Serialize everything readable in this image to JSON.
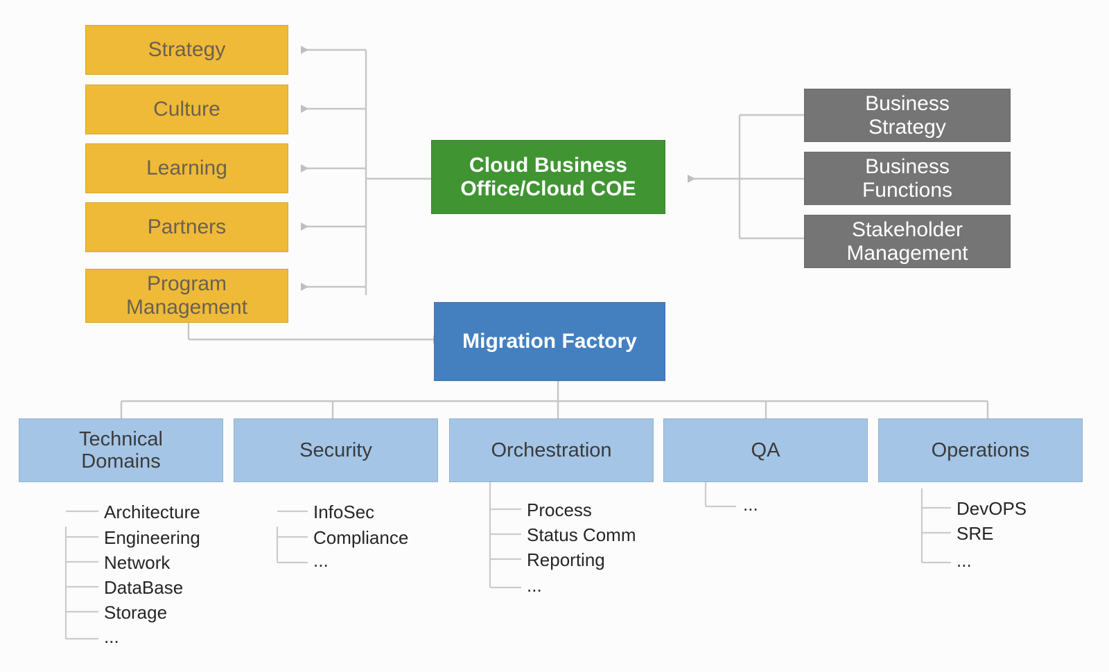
{
  "diagram": {
    "title": "Cloud Business Office / Migration Factory operating model",
    "colors": {
      "yellow": "#EFBA37",
      "green": "#409532",
      "gray": "#757575",
      "blue": "#4480C0",
      "light_blue": "#A4C5E5",
      "connector": "#BFBFBF",
      "background": "#FCFCFC"
    }
  },
  "hub": {
    "label": "Cloud Business\nOffice/Cloud COE",
    "line1": "Cloud Business",
    "line2": "Office/Cloud COE"
  },
  "factory": {
    "label": "Migration Factory"
  },
  "left_pillars": [
    {
      "label": "Strategy",
      "line1": "Strategy",
      "line2": ""
    },
    {
      "label": "Culture",
      "line1": "Culture",
      "line2": ""
    },
    {
      "label": "Learning",
      "line1": "Learning",
      "line2": ""
    },
    {
      "label": "Partners",
      "line1": "Partners",
      "line2": ""
    },
    {
      "label": "Program Management",
      "line1": "Program",
      "line2": "Management"
    }
  ],
  "right_inputs": [
    {
      "label": "Business Strategy",
      "line1": "Business",
      "line2": "Strategy"
    },
    {
      "label": "Business Functions",
      "line1": "Business",
      "line2": "Functions"
    },
    {
      "label": "Stakeholder Management",
      "line1": "Stakeholder",
      "line2": "Management"
    }
  ],
  "factory_tracks": [
    {
      "label": "Technical Domains",
      "line1": "Technical",
      "line2": "Domains",
      "items": [
        "Architecture",
        "Engineering",
        "Network",
        "DataBase",
        "Storage",
        "..."
      ]
    },
    {
      "label": "Security",
      "line1": "Security",
      "line2": "",
      "items": [
        "InfoSec",
        "Compliance",
        "..."
      ]
    },
    {
      "label": "Orchestration",
      "line1": "Orchestration",
      "line2": "",
      "items": [
        "Process",
        "Status Comm",
        "Reporting",
        "..."
      ]
    },
    {
      "label": "QA",
      "line1": "QA",
      "line2": "",
      "items": [
        "..."
      ]
    },
    {
      "label": "Operations",
      "line1": "Operations",
      "line2": "",
      "items": [
        "DevOPS",
        "SRE",
        "..."
      ]
    }
  ]
}
